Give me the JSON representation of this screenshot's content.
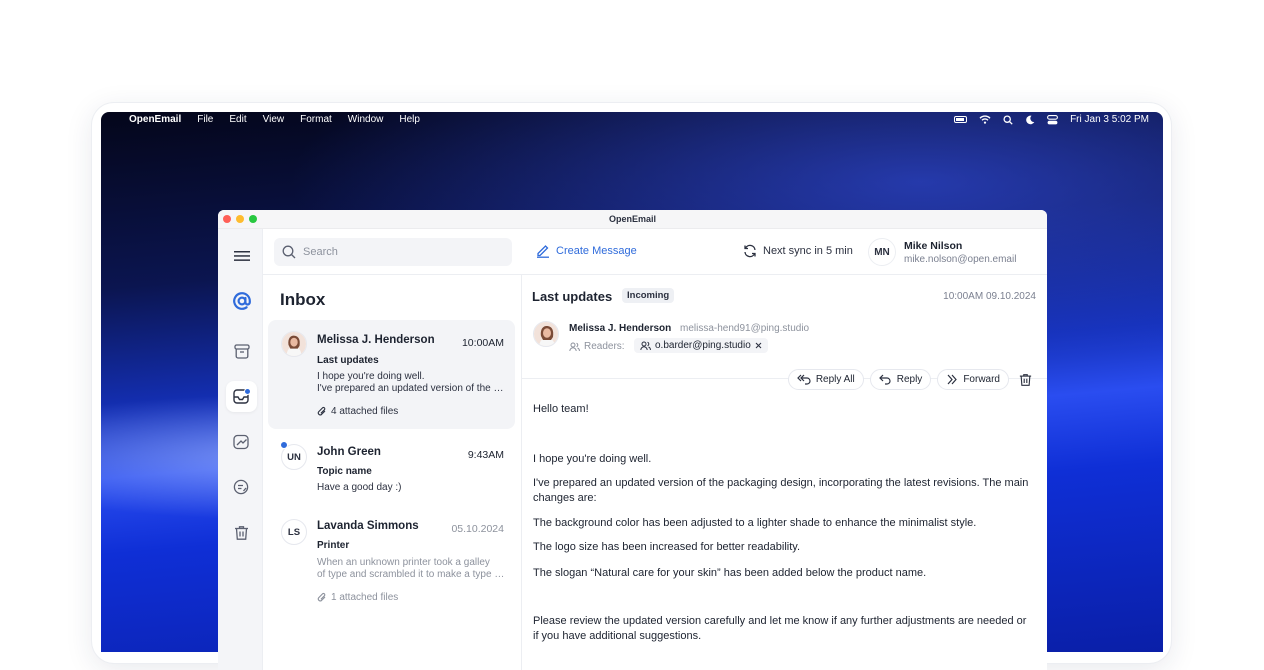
{
  "menubar": {
    "app": "OpenEmail",
    "items": [
      "File",
      "Edit",
      "View",
      "Format",
      "Window",
      "Help"
    ],
    "clock": "Fri Jan 3  5:02 PM"
  },
  "window": {
    "title": "OpenEmail",
    "traffic_colors": [
      "#ff5f57",
      "#febc2e",
      "#28c840"
    ]
  },
  "toolbar": {
    "search_placeholder": "Search",
    "create_label": "Create Message",
    "sync_label": "Next sync in 5 min",
    "user_initials": "MN",
    "user_name": "Mike Nilson",
    "user_email": "mike.nolson@open.email"
  },
  "rail": {
    "icons": [
      "menu-icon",
      "at-icon",
      "archive-icon",
      "inbox-icon",
      "sent-icon",
      "drafts-icon",
      "trash-icon"
    ],
    "accent": "#2f6bdb"
  },
  "inbox": {
    "title": "Inbox",
    "mails": [
      {
        "sender": "Melissa J. Henderson",
        "time": "10:00AM",
        "subject": "Last updates",
        "preview1": "I hope you're doing well.",
        "preview2": "I've prepared an updated version of the packaging design",
        "attachments": "4 attached files"
      },
      {
        "initials": "UN",
        "sender": "John Green",
        "time": "9:43AM",
        "subject": "Topic name",
        "preview1": "Have a good day :)"
      },
      {
        "initials": "LS",
        "sender": "Lavanda Simmons",
        "time": "05.10.2024",
        "subject": "Printer",
        "preview1": "When an unknown printer took a galley",
        "preview2": "of type and scrambled it to make a type specimen book",
        "attachments": "1 attached files"
      }
    ]
  },
  "reader": {
    "subject": "Last updates",
    "badge": "Incoming",
    "date": "10:00AM 09.10.2024",
    "from_name": "Melissa J. Henderson",
    "from_email": "melissa-hend91@ping.studio",
    "readers_label": "Readers:",
    "reader_chip": "o.barder@ping.studio",
    "actions": {
      "reply_all": "Reply All",
      "reply": "Reply",
      "forward": "Forward"
    },
    "body": [
      "Hello team!",
      "I hope you're doing well.",
      "I've prepared an updated version of the packaging design, incorporating the latest revisions. The main changes are:",
      "The background color has been adjusted to a lighter shade to enhance the minimalist style.",
      "The logo size has been increased for better readability.",
      "The slogan “Natural care for your skin” has been added below the product name.",
      "Please review the updated version carefully and let me know if any further adjustments are needed or if you have additional suggestions."
    ]
  }
}
